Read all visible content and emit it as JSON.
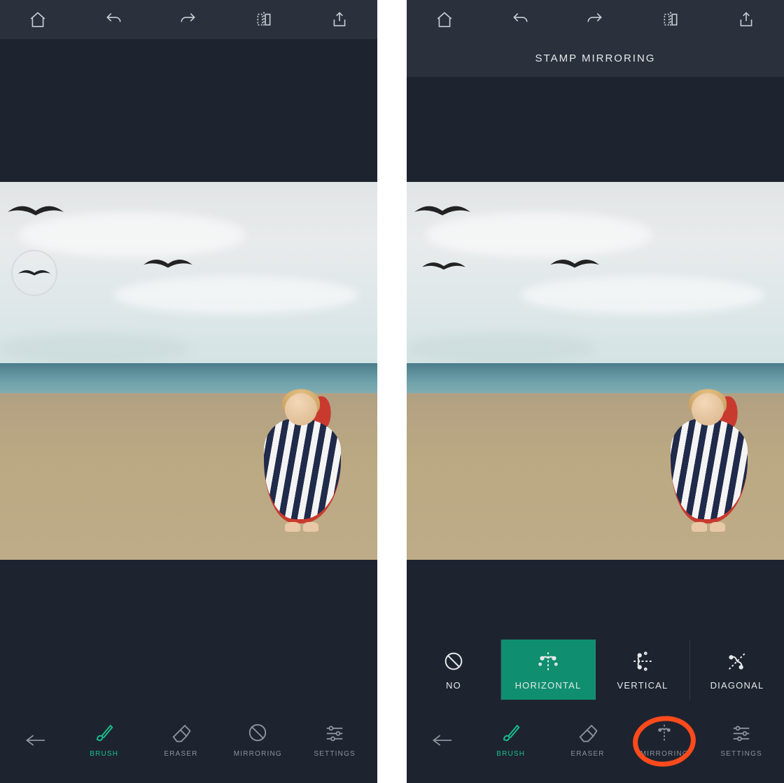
{
  "left": {
    "top_icons": [
      "home",
      "undo",
      "redo",
      "compare",
      "share"
    ],
    "bottom": {
      "back": "",
      "items": [
        {
          "key": "brush",
          "label": "BRUSH",
          "active": true
        },
        {
          "key": "eraser",
          "label": "ERASER",
          "active": false
        },
        {
          "key": "mirroring",
          "label": "MIRRORING",
          "active": false
        },
        {
          "key": "settings",
          "label": "SETTINGS",
          "active": false
        }
      ]
    }
  },
  "right": {
    "top_icons": [
      "home",
      "undo",
      "redo",
      "compare",
      "share"
    ],
    "banner": "STAMP MIRRORING",
    "mirror_options": [
      {
        "key": "no",
        "label": "NO",
        "selected": false
      },
      {
        "key": "horizontal",
        "label": "HORIZONTAL",
        "selected": true
      },
      {
        "key": "vertical",
        "label": "VERTICAL",
        "selected": false
      },
      {
        "key": "diagonal",
        "label": "DIAGONAL",
        "selected": false
      }
    ],
    "bottom": {
      "back": "",
      "items": [
        {
          "key": "brush",
          "label": "BRUSH",
          "active": true
        },
        {
          "key": "eraser",
          "label": "ERASER",
          "active": false
        },
        {
          "key": "mirroring",
          "label": "MIRRORING",
          "active": false,
          "highlighted": true
        },
        {
          "key": "settings",
          "label": "SETTINGS",
          "active": false
        }
      ]
    }
  },
  "colors": {
    "accent": "#17c08d",
    "selected": "#0f8f6f",
    "highlight": "#ff4a1c"
  }
}
